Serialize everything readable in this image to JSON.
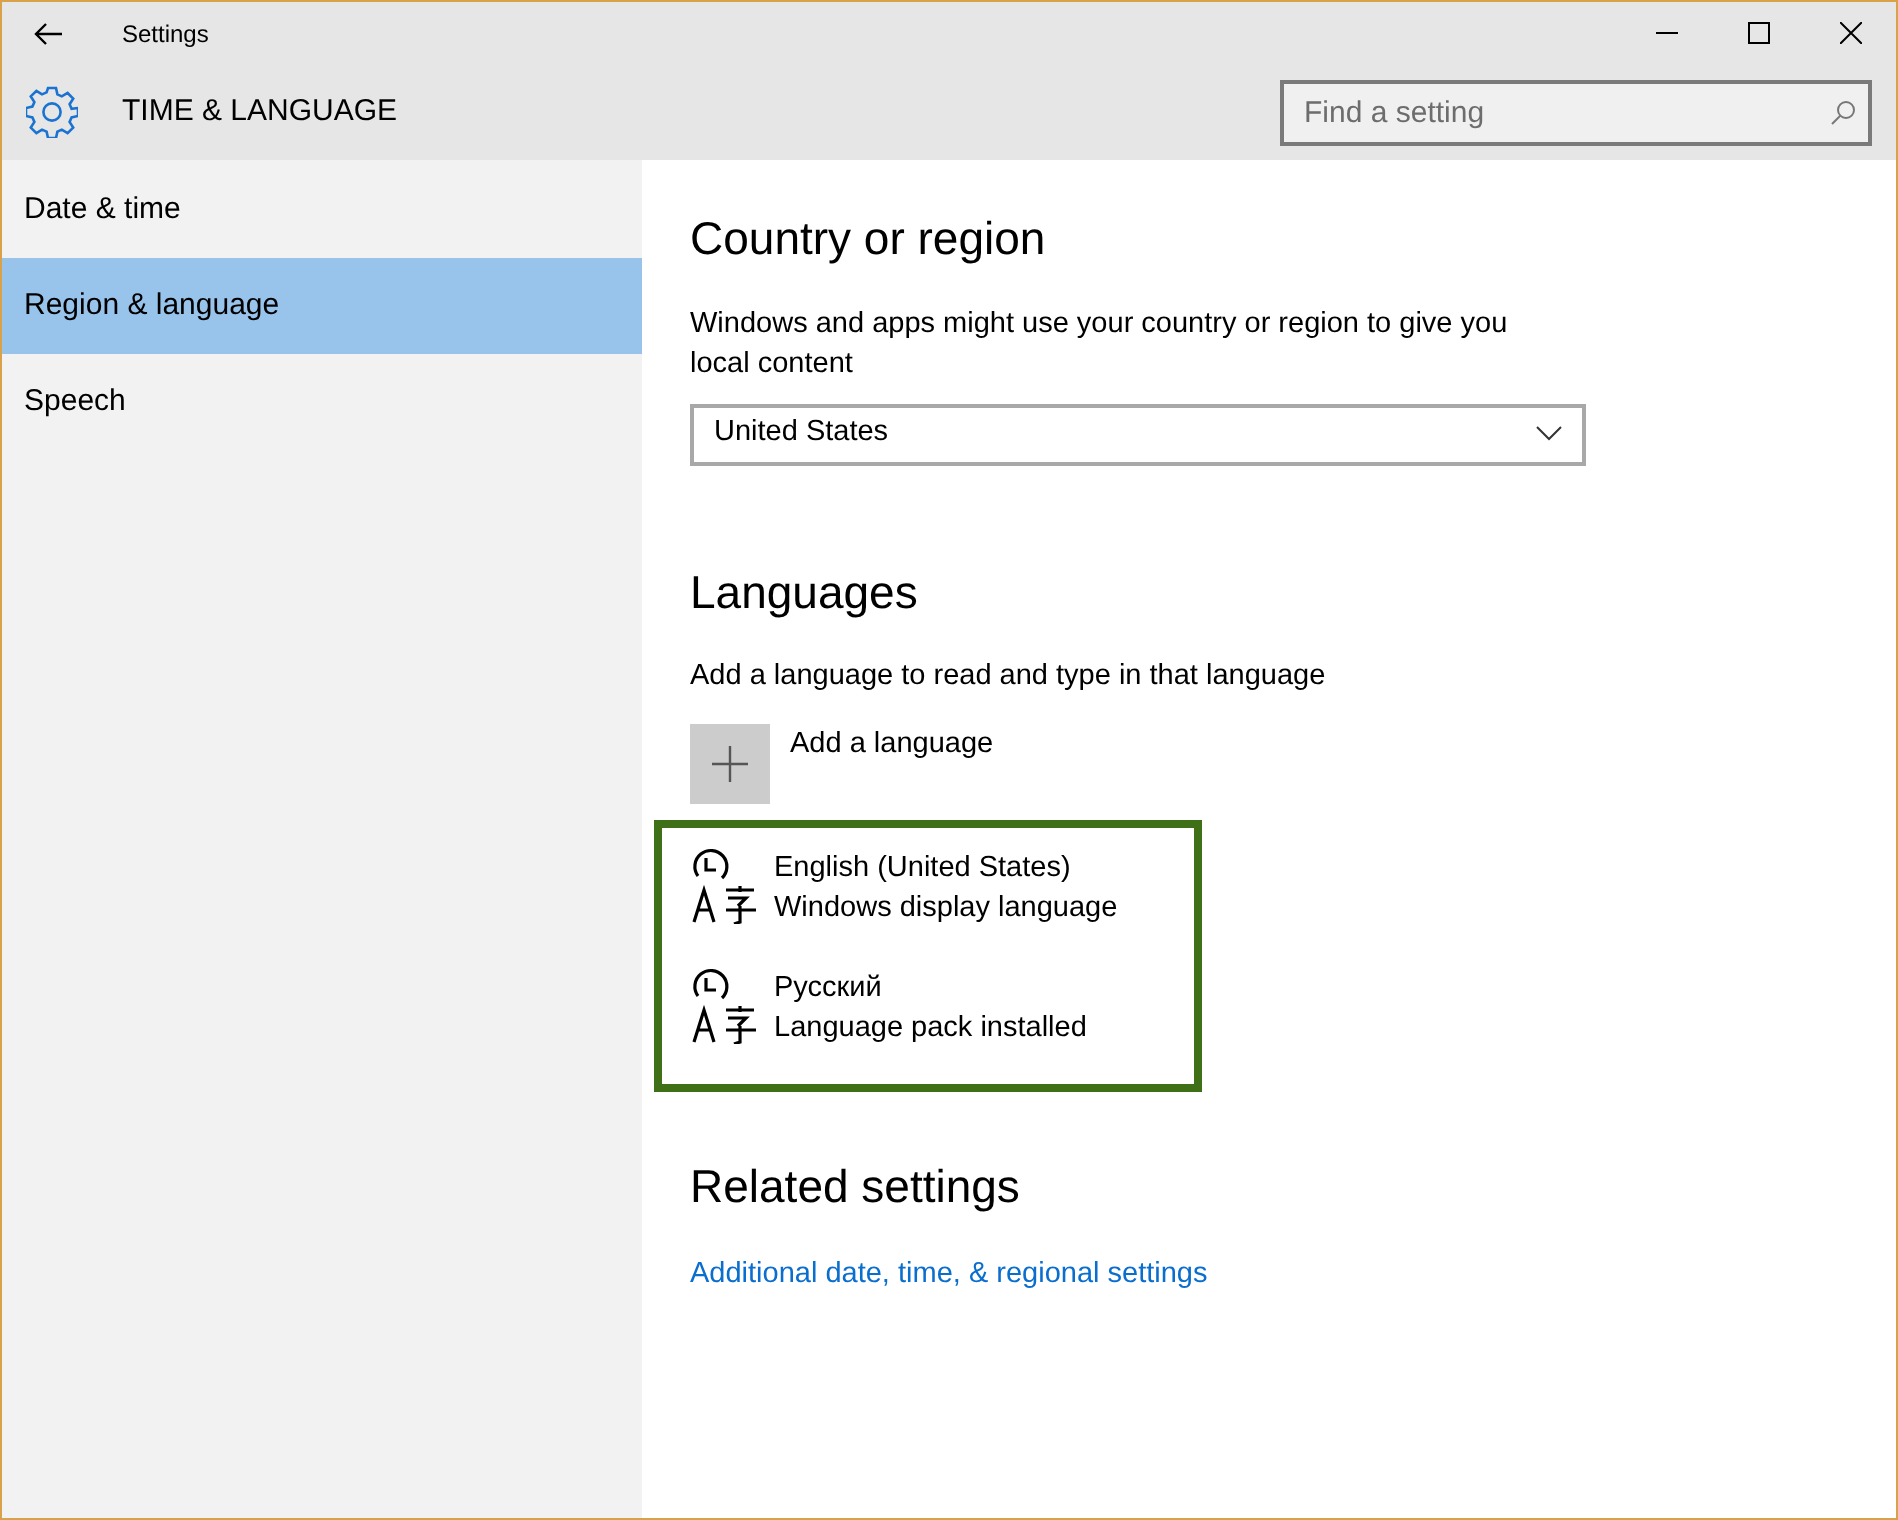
{
  "window": {
    "title": "Settings"
  },
  "header": {
    "title": "TIME & LANGUAGE",
    "search": {
      "placeholder": "Find a setting"
    }
  },
  "sidebar": {
    "items": [
      {
        "label": "Date & time",
        "selected": false
      },
      {
        "label": "Region & language",
        "selected": true
      },
      {
        "label": "Speech",
        "selected": false
      }
    ]
  },
  "country": {
    "heading": "Country or region",
    "description": "Windows and apps might use your country or region to give you local content",
    "value": "United States"
  },
  "languages": {
    "heading": "Languages",
    "description": "Add a language to read and type in that language",
    "add_label": "Add a language",
    "highlighted": true,
    "items": [
      {
        "name": "English (United States)",
        "status": "Windows display language"
      },
      {
        "name": "Русский",
        "status": "Language pack installed"
      }
    ]
  },
  "related": {
    "heading": "Related settings",
    "link": "Additional date, time, & regional settings"
  }
}
